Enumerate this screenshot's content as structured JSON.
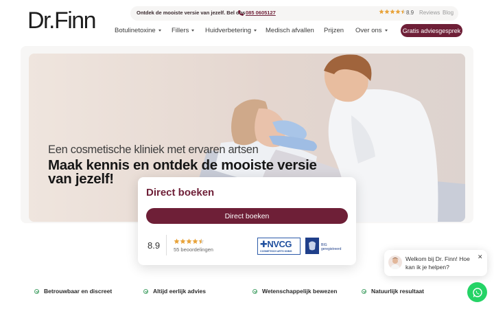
{
  "logo": {
    "text": "Dr.Finn"
  },
  "topbar": {
    "promo": "Ontdek de mooiste versie van jezelf. Bel ons",
    "phone": "085 0605127",
    "rating": "8.9",
    "reviews_link": "Reviews",
    "blog_link": "Blog"
  },
  "nav": {
    "items": [
      {
        "label": "Botulinetoxine",
        "dropdown": true
      },
      {
        "label": "Fillers",
        "dropdown": true
      },
      {
        "label": "Huidverbetering",
        "dropdown": true
      },
      {
        "label": "Medisch afvallen",
        "dropdown": false
      },
      {
        "label": "Prijzen",
        "dropdown": false
      },
      {
        "label": "Over ons",
        "dropdown": true
      }
    ],
    "cta": "Gratis adviesgesprek"
  },
  "hero": {
    "subtitle": "Een cosmetische kliniek met ervaren artsen",
    "title": "Maak kennis en ontdek de mooiste versie van jezelf!"
  },
  "booking": {
    "title": "Direct boeken",
    "button": "Direct boeken",
    "score": "8.9",
    "count": "55 beoordelingen",
    "stars": 4.5,
    "nvcg_logo": "NVCG",
    "nvcg_sub": "COSMETISCH ARTS KNMG",
    "big_line1": "BIG",
    "big_line2": "geregistreerd"
  },
  "features": [
    "Betrouwbaar en discreet",
    "Altijd eerlijk advies",
    "Wetenschappelijk bewezen",
    "Natuurlijk resultaat"
  ],
  "chat": {
    "message": "Welkom bij Dr. Finn! Hoe kan ik je helpen?",
    "close": "✕"
  },
  "colors": {
    "brand": "#6e1f37",
    "star": "#e8a33a",
    "whatsapp": "#25d366",
    "check": "#4aa36a"
  },
  "icons": {
    "phone": "phone-icon",
    "star": "star-icon",
    "check": "check-circle-icon",
    "whatsapp": "whatsapp-icon",
    "close": "close-icon",
    "caret": "chevron-down-icon"
  }
}
